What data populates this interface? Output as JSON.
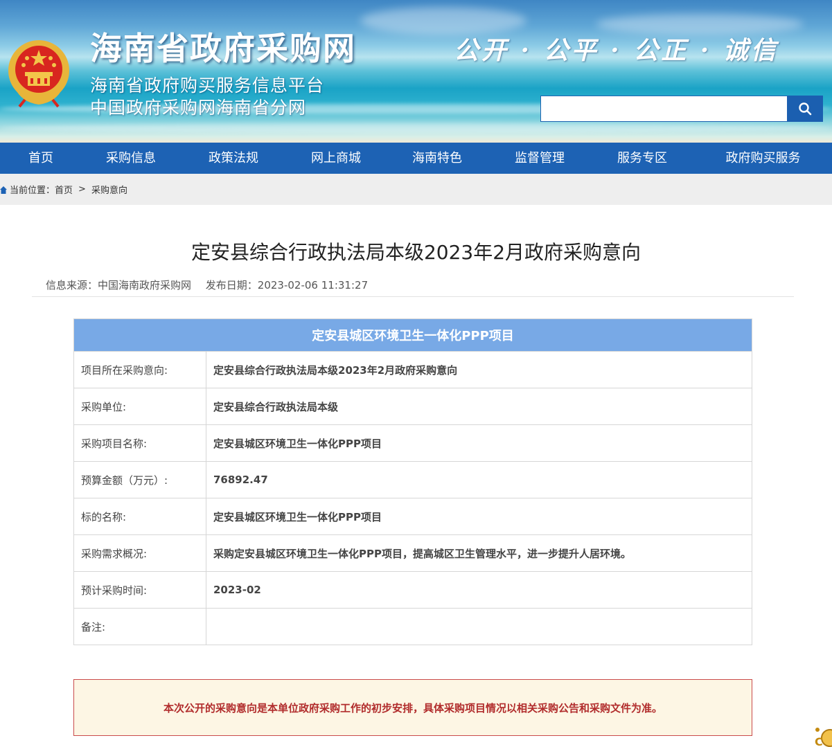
{
  "header": {
    "site_title": "海南省政府采购网",
    "subtitle_1": "海南省政府购买服务信息平台",
    "subtitle_2": "中国政府采购网海南省分网",
    "slogan": "公开 · 公平 · 公正 · 诚信",
    "search": {
      "value": "",
      "placeholder": ""
    }
  },
  "nav": {
    "items": [
      {
        "label": "首页"
      },
      {
        "label": "采购信息"
      },
      {
        "label": "政策法规"
      },
      {
        "label": "网上商城"
      },
      {
        "label": "海南特色"
      },
      {
        "label": "监督管理"
      },
      {
        "label": "服务专区"
      },
      {
        "label": "政府购买服务"
      }
    ]
  },
  "breadcrumb": {
    "prefix": "当前位置：",
    "home": "首页",
    "separator": ">",
    "current": "采购意向"
  },
  "article": {
    "title": "定安县综合行政执法局本级2023年2月政府采购意向",
    "source": "信息来源：中国海南政府采购网",
    "date": "发布日期：2023-02-06 11:31:27"
  },
  "table": {
    "heading": "定安县城区环境卫生一体化PPP项目",
    "rows": [
      {
        "label": "项目所在采购意向:",
        "value": "定安县综合行政执法局本级2023年2月政府采购意向"
      },
      {
        "label": "采购单位:",
        "value": "定安县综合行政执法局本级"
      },
      {
        "label": "采购项目名称:",
        "value": "定安县城区环境卫生一体化PPP项目"
      },
      {
        "label": "预算金额（万元）:",
        "value": "76892.47"
      },
      {
        "label": "标的名称:",
        "value": "定安县城区环境卫生一体化PPP项目"
      },
      {
        "label": "采购需求概况:",
        "value": "采购定安县城区环境卫生一体化PPP项目，提高城区卫生管理水平，进一步提升人居环境。"
      },
      {
        "label": "预计采购时间:",
        "value": "2023-02"
      },
      {
        "label": "备注:",
        "value": ""
      }
    ]
  },
  "notice": {
    "text": "本次公开的采购意向是本单位政府采购工作的初步安排，具体采购项目情况以相关采购公告和采购文件为准。"
  },
  "colors": {
    "nav_bg": "#1d62b4",
    "table_header_bg": "#78a9e6",
    "notice_text": "#b12c2c",
    "notice_border": "#c94a4a",
    "notice_bg": "#fdf6e4"
  }
}
